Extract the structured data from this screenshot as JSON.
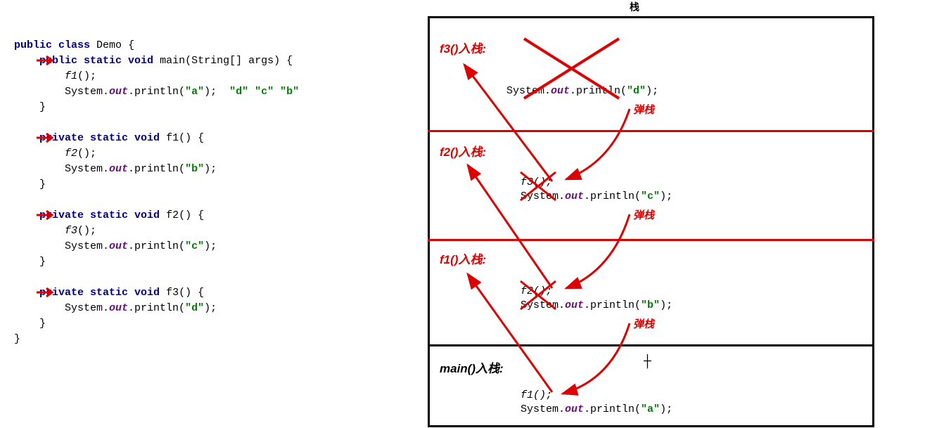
{
  "stack_title": "栈",
  "code": {
    "class_kw": "public class",
    "class_name": "Demo",
    "main_sig_kw": "public static void",
    "main_name": "main",
    "main_args": "(String[] args) {",
    "main_call": "f1",
    "main_print_pre": "System.",
    "out": "out",
    "print_fn": ".println(",
    "a": "\"a\"",
    "b": "\"b\"",
    "c": "\"c\"",
    "d": "\"d\"",
    "priv_kw": "private static void",
    "f1_name": "f1",
    "f1_call": "f2",
    "f2_name": "f2",
    "f2_call": "f3",
    "f3_name": "f3",
    "close": ");",
    "sc": "();",
    "brace_o": " {",
    "brace_c": "}",
    "extra_d": "\"d\"",
    "extra_c": "\"c\"",
    "extra_b": "\"b\""
  },
  "frames": {
    "f3": {
      "label": "f3()入栈:",
      "code_pre": "System.",
      "out": "out",
      "tail": ".println(",
      "val": "\"d\"",
      "close": ");"
    },
    "f2": {
      "label": "f2()入栈:",
      "call": "f3();",
      "code_pre": "System.",
      "out": "out",
      "tail": ".println(",
      "val": "\"c\"",
      "close": ");"
    },
    "f1": {
      "label": "f1()入栈:",
      "call": "f2();",
      "code_pre": "System.",
      "out": "out",
      "tail": ".println(",
      "val": "\"b\"",
      "close": ");"
    },
    "main": {
      "label": "main()入栈:",
      "call": "f1();",
      "code_pre": "System.",
      "out": "out",
      "tail": ".println(",
      "val": "\"a\"",
      "close": ");"
    }
  },
  "pop_label": "弹栈"
}
